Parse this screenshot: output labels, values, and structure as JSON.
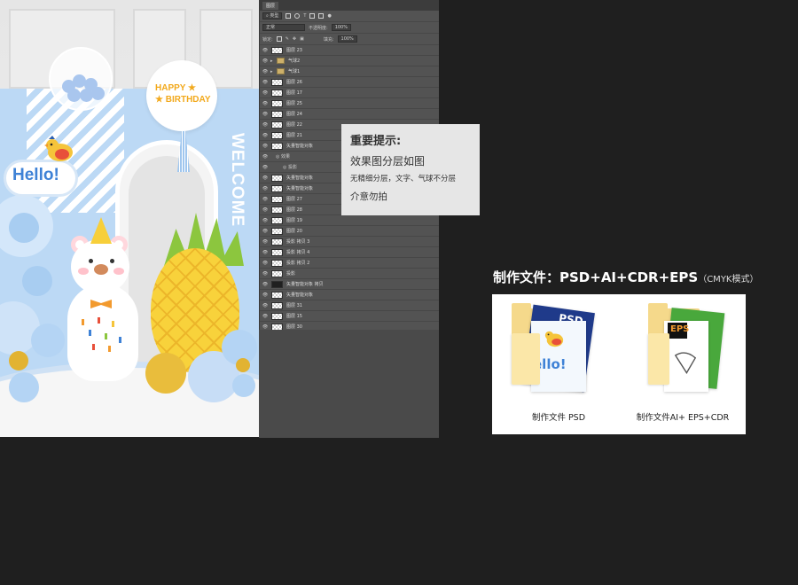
{
  "artwork": {
    "welcome_text": "WELCOME",
    "birthday_line1": "HAPPY ★",
    "birthday_line2": "★ BIRTHDAY",
    "hello_text": "Hello!"
  },
  "layers_panel": {
    "tab_label": "图层",
    "filter_kind": "类型",
    "blend_mode": "正常",
    "opacity_label": "不透明度:",
    "opacity_value": "100%",
    "lock_label": "锁定:",
    "fill_label": "填充:",
    "fill_value": "100%",
    "layers": [
      {
        "name": "图层 23",
        "kind": "pixel"
      },
      {
        "name": "气球2",
        "kind": "group"
      },
      {
        "name": "气球1",
        "kind": "group"
      },
      {
        "name": "图层 26",
        "kind": "pixel"
      },
      {
        "name": "图层 17",
        "kind": "pixel"
      },
      {
        "name": "图层 25",
        "kind": "pixel"
      },
      {
        "name": "图层 24",
        "kind": "pixel"
      },
      {
        "name": "图层 22",
        "kind": "pixel"
      },
      {
        "name": "图层 21",
        "kind": "pixel"
      },
      {
        "name": "矢量智能对象",
        "kind": "pixel"
      },
      {
        "name": "效果",
        "kind": "effect"
      },
      {
        "name": "投影",
        "kind": "effect-item"
      },
      {
        "name": "矢量智能对象",
        "kind": "pixel"
      },
      {
        "name": "矢量智能对象",
        "kind": "pixel"
      },
      {
        "name": "图层 27",
        "kind": "pixel"
      },
      {
        "name": "图层 28",
        "kind": "pixel"
      },
      {
        "name": "图层 19",
        "kind": "pixel"
      },
      {
        "name": "图层 20",
        "kind": "pixel"
      },
      {
        "name": "投影 拷贝 3",
        "kind": "pixel"
      },
      {
        "name": "投影 拷贝 4",
        "kind": "pixel"
      },
      {
        "name": "投影 拷贝 2",
        "kind": "pixel"
      },
      {
        "name": "投影",
        "kind": "pixel"
      },
      {
        "name": "矢量智能对象 拷贝",
        "kind": "dark"
      },
      {
        "name": "矢量智能对象",
        "kind": "pixel"
      },
      {
        "name": "图层 31",
        "kind": "pixel"
      },
      {
        "name": "图层 15",
        "kind": "pixel"
      },
      {
        "name": "图层 30",
        "kind": "pixel"
      }
    ]
  },
  "notice": {
    "title": "重要提示:",
    "line1": "效果图分层如图",
    "line2": "无精细分层，文字、气球不分层",
    "line3": "介意勿拍"
  },
  "formats": {
    "heading": "制作文件：PSD+AI+CDR+EPS",
    "heading_note": "（CMYK模式）",
    "files": [
      {
        "label": "制作文件 PSD",
        "badge": "PSD",
        "doc_text": "ello!"
      },
      {
        "label": "制作文件AI+ EPS+CDR",
        "badge": "EPS"
      }
    ]
  },
  "colors": {
    "background": "#1f1f1f",
    "panel": "#535353",
    "notice_bg": "#e6e6e6",
    "backdrop_blue": "#bcd9f5",
    "hello_blue": "#3f82d6",
    "birthday_gold": "#f2a91c"
  }
}
